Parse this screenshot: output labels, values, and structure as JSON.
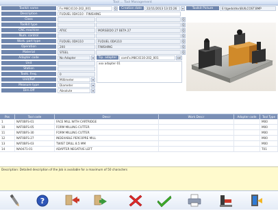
{
  "window": {
    "title": "Tool ... Tool Management"
  },
  "form": {
    "rows_left": [
      {
        "label": "Toolkit name",
        "value": "Fx M8C4110-202_001"
      },
      {
        "label": "Description",
        "value": "FUDUEL 0DA110 - FINISHING"
      },
      {
        "label": "Class",
        "value": ""
      },
      {
        "label": "Toolkit type",
        "value": ""
      },
      {
        "label": "CNC machine",
        "value": "AT6C",
        "value2": "MORSEIDO 27 BETA 27"
      },
      {
        "label": "Num. control",
        "value": ""
      },
      {
        "label": "Work. part type",
        "value": "FUDUEL 0DA110",
        "value2": "FUDUEL 0DA110"
      },
      {
        "label": "Operation",
        "value": "200",
        "value2": "FINISHING"
      },
      {
        "label": "Material",
        "value": "STEEL"
      },
      {
        "label": "Adapter code",
        "value": "No Adapter",
        "tip_label": "Tip. adapter",
        "tip_value": "comFx.M8C4110-202_001",
        "tip_btn": "sel"
      },
      {
        "label": "Unit",
        "value": "",
        "note": "xxx adapter 01"
      },
      {
        "label": "Station",
        "value": ""
      },
      {
        "label": "Toolk. freq.",
        "value": "0"
      },
      {
        "label": "Unit/Ref",
        "value": "Millimeter"
      },
      {
        "label": "Measure type",
        "value": "Diameter"
      },
      {
        "label": "Dim.Off",
        "value": "Absolute"
      }
    ],
    "creation_label": "Creation date",
    "creation_value": "22/11/2013 13:15:26",
    "picture_label": "Toolkit Picture",
    "picture_value": "E:\\tgedo\\tkv\\BUILCOST.BMP"
  },
  "grid": {
    "columns": [
      "Pos",
      "Tool code",
      "Descr",
      "Work Descr",
      "Adapter code",
      "Tool Type"
    ],
    "rows": [
      {
        "pos": "1",
        "code": "NAT0BFS-01",
        "descr": "FACE MILL WITH CARTRIDGE",
        "work": "",
        "adapter": "",
        "type": "M00"
      },
      {
        "pos": "10",
        "code": "NAT0BFS-05",
        "descr": "FORM MILLING CUTTER",
        "work": "",
        "adapter": "",
        "type": "M00"
      },
      {
        "pos": "11",
        "code": "NAT0BFS-30",
        "descr": "FORM MILLING CUTTER",
        "work": "",
        "adapter": "",
        "type": "M00"
      },
      {
        "pos": "12",
        "code": "NAT0BFS-27",
        "descr": "INDEXABLE PERCOPRE MILL",
        "work": "",
        "adapter": "",
        "type": "M00"
      },
      {
        "pos": "13",
        "code": "NAT0BFS-03",
        "descr": "TWIST DRILL 8.5 MM",
        "work": "",
        "adapter": "",
        "type": "M00"
      },
      {
        "pos": "14",
        "code": "NA0471-01",
        "descr": "ADAPTER NEGATIVE LEFT",
        "work": "",
        "adapter": "",
        "type": "T01"
      }
    ]
  },
  "description": {
    "text": "Description: Detailed description of the Job is available for a maximum of 50 characters"
  },
  "toolbar": {
    "buttons": [
      "pen-icon",
      "help-icon",
      "arrow-in-icon",
      "arrow-out-icon",
      "delete-icon",
      "confirm-icon",
      "print-icon",
      "machine-icon",
      "exit-icon"
    ]
  },
  "colors": {
    "label_bg": "#6f86ad",
    "header_bg": "#7a8fb5",
    "desc_bg": "#fffacd"
  }
}
